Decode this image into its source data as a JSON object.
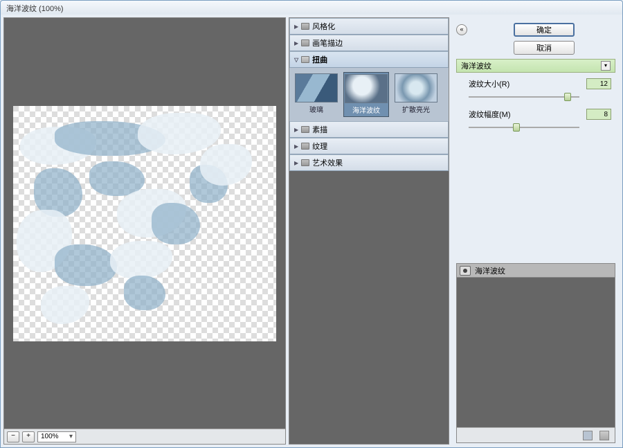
{
  "window": {
    "title": "海洋波纹 (100%)"
  },
  "preview": {
    "zoom": "100%"
  },
  "categories": [
    {
      "id": "stylize",
      "label": "风格化",
      "expanded": false
    },
    {
      "id": "brush",
      "label": "画笔描边",
      "expanded": false
    },
    {
      "id": "distort",
      "label": "扭曲",
      "expanded": true,
      "selected": true
    },
    {
      "id": "sketch",
      "label": "素描",
      "expanded": false
    },
    {
      "id": "texture",
      "label": "纹理",
      "expanded": false
    },
    {
      "id": "artistic",
      "label": "艺术效果",
      "expanded": false
    }
  ],
  "distort_filters": [
    {
      "id": "glass",
      "label": "玻璃",
      "selected": false
    },
    {
      "id": "ocean",
      "label": "海洋波纹",
      "selected": true
    },
    {
      "id": "diffuse",
      "label": "扩散亮光",
      "selected": false
    }
  ],
  "buttons": {
    "ok": "确定",
    "cancel": "取消"
  },
  "current_filter": {
    "name": "海洋波纹"
  },
  "params": {
    "ripple_size": {
      "label": "波纹大小(R)",
      "value": "12",
      "min": 1,
      "max": 15,
      "pos": 86
    },
    "ripple_mag": {
      "label": "波纹幅度(M)",
      "value": "8",
      "min": 0,
      "max": 20,
      "pos": 40
    }
  },
  "layers": [
    {
      "name": "海洋波纹",
      "visible": true
    }
  ]
}
